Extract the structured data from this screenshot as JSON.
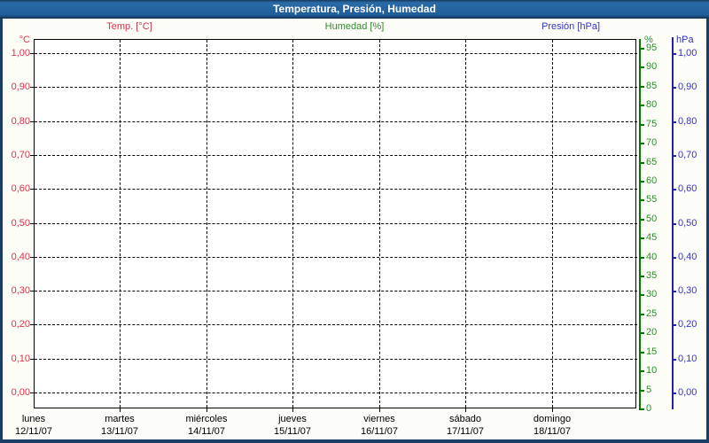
{
  "window": {
    "title": "Temperatura, Presión, Humedad"
  },
  "legend": {
    "temp": {
      "label": "Temp. [°C]",
      "color": "#d8334a"
    },
    "humidity": {
      "label": "Humedad [%]",
      "color": "#2e8b2e"
    },
    "pressure": {
      "label": "Presión [hPa]",
      "color": "#3333cc"
    }
  },
  "chart_data": {
    "type": "line",
    "title": "Temperatura, Presión, Humedad",
    "grid": true,
    "plot_content": "empty — no data series drawn in plot area",
    "series": [
      {
        "name": "Temp. [°C]",
        "axis": "temp",
        "color": "#d8334a",
        "values": []
      },
      {
        "name": "Humedad [%]",
        "axis": "humidity",
        "color": "#2e8b2e",
        "values": []
      },
      {
        "name": "Presión [hPa]",
        "axis": "pressure",
        "color": "#3333cc",
        "values": []
      }
    ],
    "axes": {
      "temp": {
        "header": "°C",
        "position": "left",
        "color": "#d8334a",
        "ylim": [
          0,
          1
        ],
        "tick_values": [
          1.0,
          0.9,
          0.8,
          0.7,
          0.6,
          0.5,
          0.4,
          0.3,
          0.2,
          0.1,
          0.0
        ],
        "tick_labels": [
          "1,00",
          "0,90",
          "0,80",
          "0,70",
          "0,60",
          "0,50",
          "0,40",
          "0,30",
          "0,20",
          "0,10",
          "0,00"
        ]
      },
      "humidity": {
        "header": "%",
        "position": "right-inner",
        "color": "#2e8b2e",
        "line_color": "#007700",
        "ylim": [
          0,
          95
        ],
        "tick_values": [
          95,
          90,
          85,
          80,
          75,
          70,
          65,
          60,
          55,
          50,
          45,
          40,
          35,
          30,
          25,
          20,
          15,
          10,
          5,
          0
        ],
        "tick_labels": [
          "95",
          "90",
          "85",
          "80",
          "75",
          "70",
          "65",
          "60",
          "55",
          "50",
          "45",
          "40",
          "35",
          "30",
          "25",
          "20",
          "15",
          "10",
          "5",
          "0"
        ]
      },
      "pressure": {
        "header": "hPa",
        "position": "right-outer",
        "color": "#3333cc",
        "line_color": "#2222aa",
        "ylim": [
          0,
          1
        ],
        "tick_values": [
          1.0,
          0.9,
          0.8,
          0.7,
          0.6,
          0.5,
          0.4,
          0.3,
          0.2,
          0.1,
          0.0
        ],
        "tick_labels": [
          "1,00",
          "0,90",
          "0,80",
          "0,70",
          "0,60",
          "0,50",
          "0,40",
          "0,30",
          "0,20",
          "0,10",
          "0,00"
        ]
      }
    },
    "x_axis": {
      "categories": [
        {
          "name": "lunes",
          "date": "12/11/07"
        },
        {
          "name": "martes",
          "date": "13/11/07"
        },
        {
          "name": "miércoles",
          "date": "14/11/07"
        },
        {
          "name": "jueves",
          "date": "15/11/07"
        },
        {
          "name": "viernes",
          "date": "16/11/07"
        },
        {
          "name": "sábado",
          "date": "17/11/07"
        },
        {
          "name": "domingo",
          "date": "18/11/07"
        }
      ]
    }
  },
  "colors": {
    "frame_border": "#1c3e66",
    "titlebar_blue": "#1f5e9b",
    "plot_background": "#ffffff",
    "page_background": "#fdfdf8",
    "gridline": "#000000"
  }
}
